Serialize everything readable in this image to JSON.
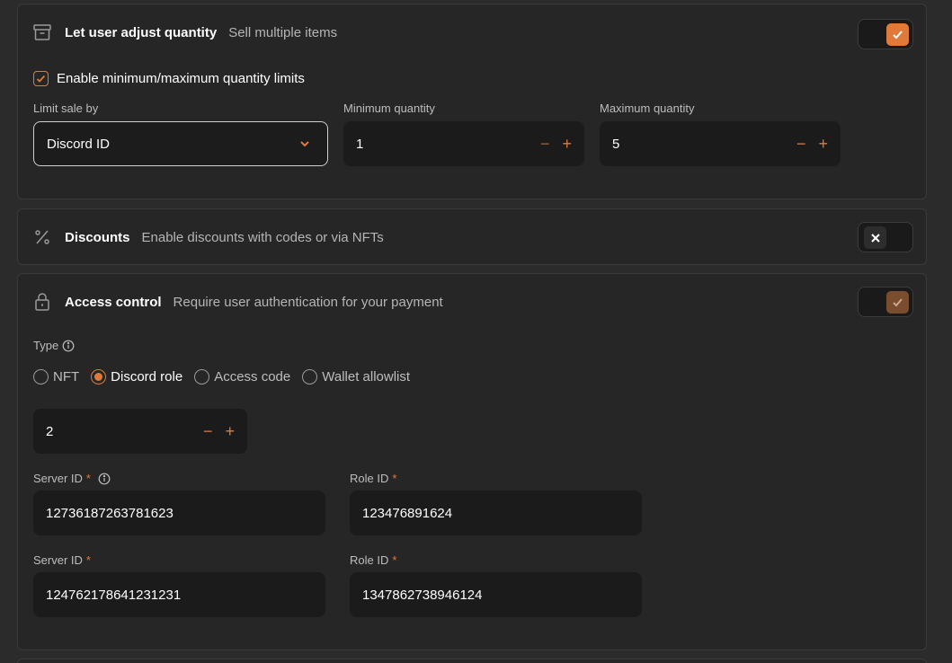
{
  "quantity": {
    "title": "Let user adjust quantity",
    "subtitle": "Sell multiple items",
    "icon": "archive-box-icon",
    "enabled": true,
    "limits_checkbox_label": "Enable minimum/maximum quantity limits",
    "limit_sale_by_label": "Limit sale by",
    "limit_sale_by_value": "Discord ID",
    "min_label": "Minimum quantity",
    "min_value": "1",
    "max_label": "Maximum quantity",
    "max_value": "5"
  },
  "discounts": {
    "title": "Discounts",
    "subtitle": "Enable discounts with codes or via NFTs",
    "icon": "percent-icon",
    "enabled": false
  },
  "access": {
    "title": "Access control",
    "subtitle": "Require user authentication for your payment",
    "icon": "lock-icon",
    "enabled": true,
    "type_label": "Type",
    "options": [
      "NFT",
      "Discord role",
      "Access code",
      "Wallet allowlist"
    ],
    "selected_option": "Discord role",
    "count_value": "2",
    "server_id_label": "Server ID",
    "role_id_label": "Role ID",
    "required_mark": "*",
    "rows": [
      {
        "server_id": "12736187263781623",
        "role_id": "123476891624"
      },
      {
        "server_id": "124762178641231231",
        "role_id": "1347862738946124"
      }
    ]
  },
  "colors": {
    "accent": "#e07a3a",
    "background": "#2b2b2b",
    "card": "#262626",
    "field": "#1b1b1b"
  }
}
